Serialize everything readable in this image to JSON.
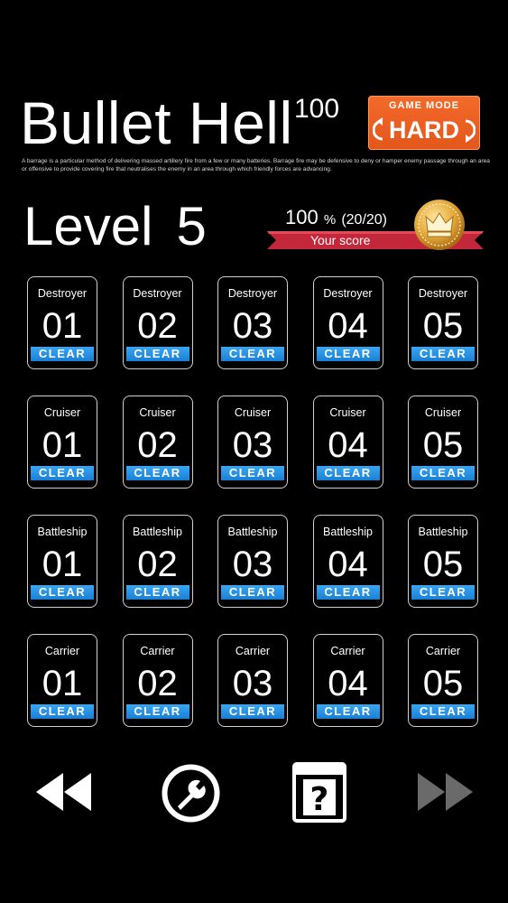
{
  "header": {
    "title": "Bullet Hell",
    "title_sup": "100",
    "game_mode_label": "GAME MODE",
    "game_mode_value": "HARD",
    "description": "A barrage is a particular method of delivering massed artillery fire from a few or many batteries. Barrage fire may be defensive to deny or hamper enemy passage through an area or offensive to provide covering fire that neutralises the enemy in an area through which friendly forces are advancing."
  },
  "level": {
    "label": "Level",
    "number": "5"
  },
  "score": {
    "percent": "100",
    "percent_sign": "%",
    "fraction": "(20/20)",
    "label": "Your score",
    "ribbon_color": "#c4273a",
    "medal_color": "#e3a93b"
  },
  "colors": {
    "accent_orange": "#e95b1f",
    "clear_blue": "#2a90e4"
  },
  "stages": [
    {
      "type": "Destroyer",
      "items": [
        {
          "num": "01",
          "status": "CLEAR"
        },
        {
          "num": "02",
          "status": "CLEAR"
        },
        {
          "num": "03",
          "status": "CLEAR"
        },
        {
          "num": "04",
          "status": "CLEAR"
        },
        {
          "num": "05",
          "status": "CLEAR"
        }
      ]
    },
    {
      "type": "Cruiser",
      "items": [
        {
          "num": "01",
          "status": "CLEAR"
        },
        {
          "num": "02",
          "status": "CLEAR"
        },
        {
          "num": "03",
          "status": "CLEAR"
        },
        {
          "num": "04",
          "status": "CLEAR"
        },
        {
          "num": "05",
          "status": "CLEAR"
        }
      ]
    },
    {
      "type": "Battleship",
      "items": [
        {
          "num": "01",
          "status": "CLEAR"
        },
        {
          "num": "02",
          "status": "CLEAR"
        },
        {
          "num": "03",
          "status": "CLEAR"
        },
        {
          "num": "04",
          "status": "CLEAR"
        },
        {
          "num": "05",
          "status": "CLEAR"
        }
      ]
    },
    {
      "type": "Carrier",
      "items": [
        {
          "num": "01",
          "status": "CLEAR"
        },
        {
          "num": "02",
          "status": "CLEAR"
        },
        {
          "num": "03",
          "status": "CLEAR"
        },
        {
          "num": "04",
          "status": "CLEAR"
        },
        {
          "num": "05",
          "status": "CLEAR"
        }
      ]
    }
  ],
  "nav": {
    "prev_icon": "rewind-icon",
    "settings_icon": "wrench-icon",
    "help_icon": "help-book-icon",
    "next_icon": "fast-forward-icon",
    "next_disabled": true
  }
}
